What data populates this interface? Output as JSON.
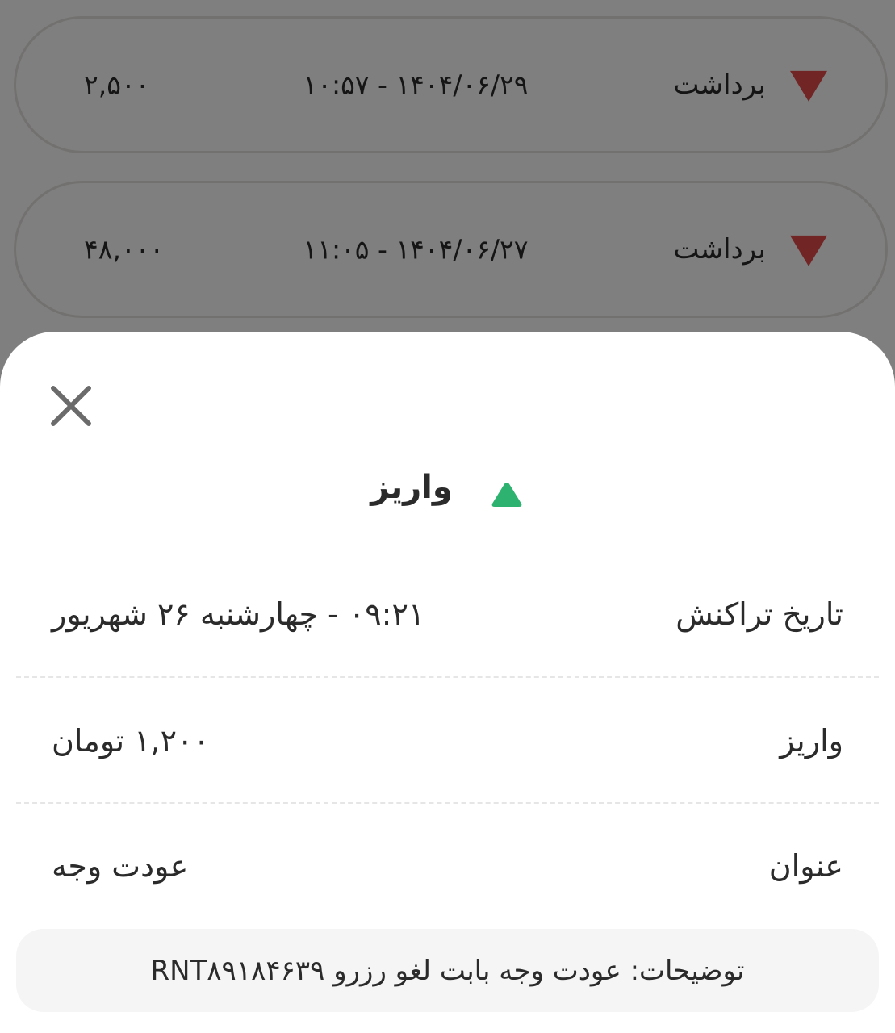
{
  "transactions": [
    {
      "type": "برداشت",
      "datetime": "۱۴۰۴/۰۶/۲۹ - ۱۰:۵۷",
      "amount": "۲,۵۰۰"
    },
    {
      "type": "برداشت",
      "datetime": "۱۴۰۴/۰۶/۲۷ - ۱۱:۰۵",
      "amount": "۴۸,۰۰۰"
    }
  ],
  "sheet": {
    "title": "واریز",
    "rows": {
      "date": {
        "label": "تاریخ تراکنش",
        "value": "۰۹:۲۱ - چهارشنبه ۲۶ شهریور"
      },
      "amount": {
        "label": "واریز",
        "value": "۱,۲۰۰ تومان"
      },
      "title": {
        "label": "عنوان",
        "value": "عودت وجه"
      }
    },
    "description": "توضیحات: عودت وجه بابت لغو رزرو RNT۸۹۱۸۴۶۳۹"
  },
  "colors": {
    "withdraw_arrow": "#e44a4a",
    "deposit_arrow": "#2db36f",
    "text": "#2b2b2b"
  },
  "icons": {
    "withdraw": "down-triangle-icon",
    "deposit": "up-triangle-icon",
    "close": "close-icon"
  }
}
